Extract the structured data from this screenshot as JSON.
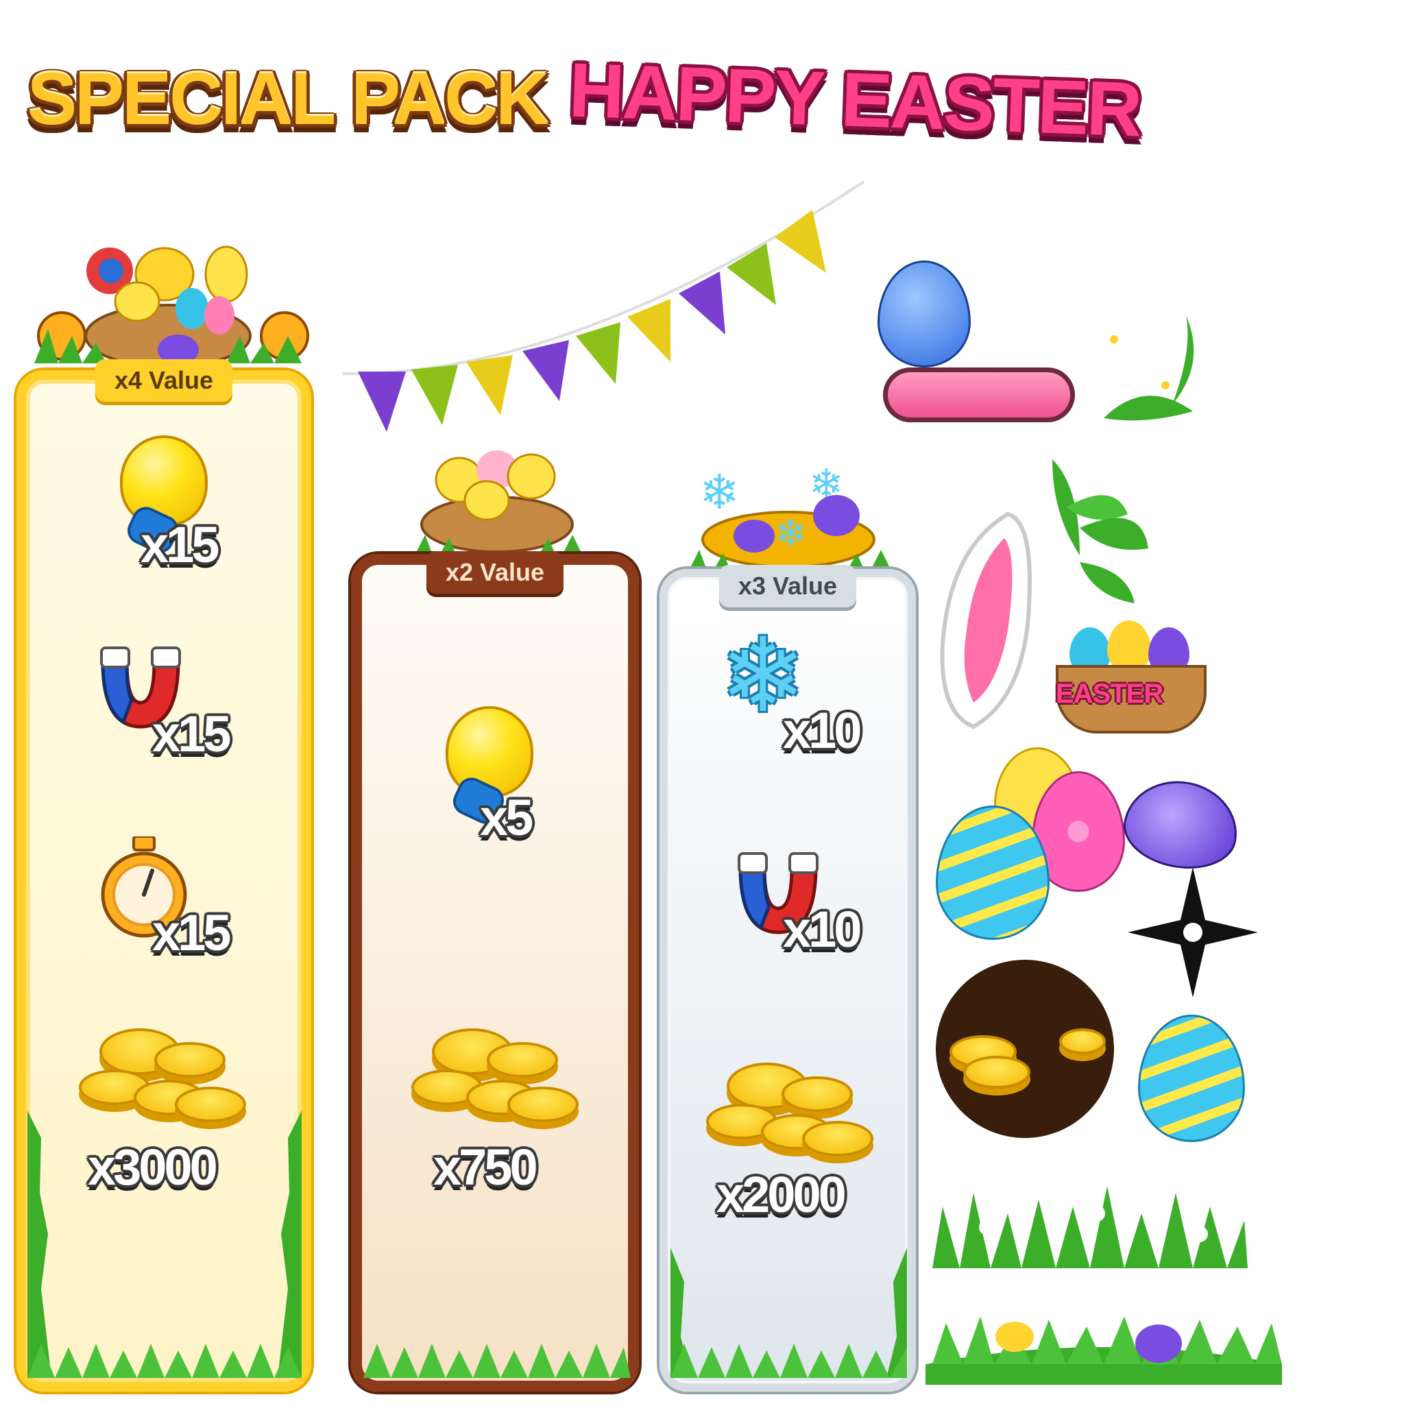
{
  "header": {
    "title_left": "SPECIAL PACK",
    "title_right": "HAPPY EASTER"
  },
  "packs": [
    {
      "tab": "x4 Value",
      "items": [
        {
          "icon": "lightbulb-icon",
          "qty": "x15"
        },
        {
          "icon": "magnet-icon",
          "qty": "x15"
        },
        {
          "icon": "stopwatch-icon",
          "qty": "x15"
        },
        {
          "icon": "coins-icon",
          "qty": "x3000"
        }
      ]
    },
    {
      "tab": "x2 Value",
      "items": [
        {
          "icon": "lightbulb-icon",
          "qty": "x5"
        },
        {
          "icon": "coins-icon",
          "qty": "x750"
        }
      ]
    },
    {
      "tab": "x3 Value",
      "items": [
        {
          "icon": "snowflake-icon",
          "qty": "x10"
        },
        {
          "icon": "magnet-icon",
          "qty": "x10"
        },
        {
          "icon": "coins-icon",
          "qty": "x2000"
        }
      ]
    }
  ],
  "assets": {
    "basket_label": "EASTER",
    "colors": {
      "gold": "#ffd12a",
      "brown": "#8b3a1b",
      "silver": "#d7dee3",
      "pink": "#ff3f86"
    }
  }
}
